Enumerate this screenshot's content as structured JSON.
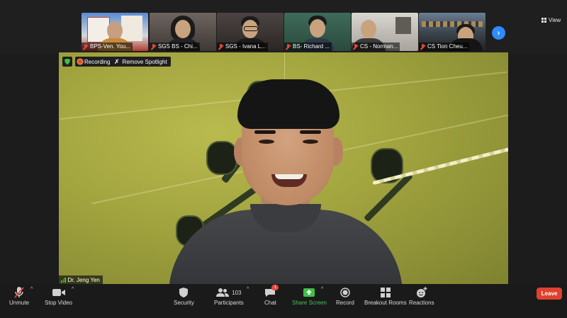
{
  "participants_strip": [
    {
      "name": "BPS-Ven. You...",
      "muted": true
    },
    {
      "name": "SGS BS - Chi...",
      "muted": true
    },
    {
      "name": "SGS - Ivana L...",
      "muted": true
    },
    {
      "name": "BS- Richard ...",
      "muted": true
    },
    {
      "name": "CS - Norman...",
      "muted": true
    },
    {
      "name": "CS Tion Cheu...",
      "muted": true
    }
  ],
  "view_label": "View",
  "next_icon": "chevron-right-icon",
  "recording_label": "Recording",
  "remove_spotlight_label": "Remove Spotlight",
  "speaker_name": "Dr. Jeng Yen",
  "toolbar": {
    "unmute": "Unmute",
    "stop_video": "Stop Video",
    "security": "Security",
    "participants": "Participants",
    "participant_count": "103",
    "chat": "Chat",
    "chat_badge": "1",
    "share_screen": "Share Screen",
    "record": "Record",
    "breakout_rooms": "Breakout Rooms",
    "reactions": "Reactions",
    "leave": "Leave"
  },
  "colors": {
    "accent_blue": "#2d8cff",
    "share_green": "#3fbf4a",
    "leave_red": "#e0412f",
    "muted_red": "#e5453b"
  }
}
